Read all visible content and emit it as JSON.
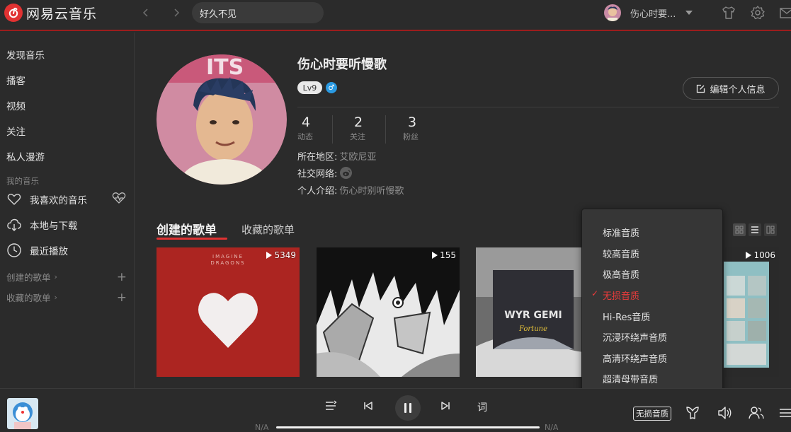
{
  "app": {
    "logo_text": "网易云音乐",
    "brand_color": "#e13232"
  },
  "topbar": {
    "search_value": "好久不见",
    "user_name": "伤心时要..."
  },
  "sidebar": {
    "items": [
      {
        "label": "发现音乐"
      },
      {
        "label": "播客"
      },
      {
        "label": "视频"
      },
      {
        "label": "关注"
      },
      {
        "label": "私人漫游"
      }
    ],
    "my_music_title": "我的音乐",
    "my_music": [
      {
        "label": "我喜欢的音乐",
        "icon": "heart-icon"
      },
      {
        "label": "本地与下载",
        "icon": "cloud-download-icon"
      },
      {
        "label": "最近播放",
        "icon": "clock-icon"
      }
    ],
    "created_title": "创建的歌单",
    "collected_title": "收藏的歌单"
  },
  "profile": {
    "name": "伤心时要听慢歌",
    "level": "Lv9",
    "gender_symbol": "♂",
    "edit_label": "编辑个人信息",
    "stats": [
      {
        "value": "4",
        "label": "动态"
      },
      {
        "value": "2",
        "label": "关注"
      },
      {
        "value": "3",
        "label": "粉丝"
      }
    ],
    "region_label": "所在地区:",
    "region_value": "艾欧尼亚",
    "social_label": "社交网络:",
    "intro_label": "个人介绍:",
    "intro_value": "伤心时别听慢歌"
  },
  "tabs": {
    "active": "创建的歌单",
    "inactive": "收藏的歌单"
  },
  "playlists": [
    {
      "plays": "5349"
    },
    {
      "plays": "155"
    },
    {
      "plays": ""
    },
    {
      "plays": "1006"
    }
  ],
  "quality_menu": {
    "options": [
      "标准音质",
      "较高音质",
      "极高音质",
      "无损音质",
      "Hi-Res音质",
      "沉浸环绕声音质",
      "高清环绕声音质",
      "超清母带音质"
    ],
    "selected": "无损音质",
    "check": "✓"
  },
  "player": {
    "lyric_label": "词",
    "time_current": "N/A",
    "time_total": "N/A",
    "quality_tag": "无损音质"
  }
}
